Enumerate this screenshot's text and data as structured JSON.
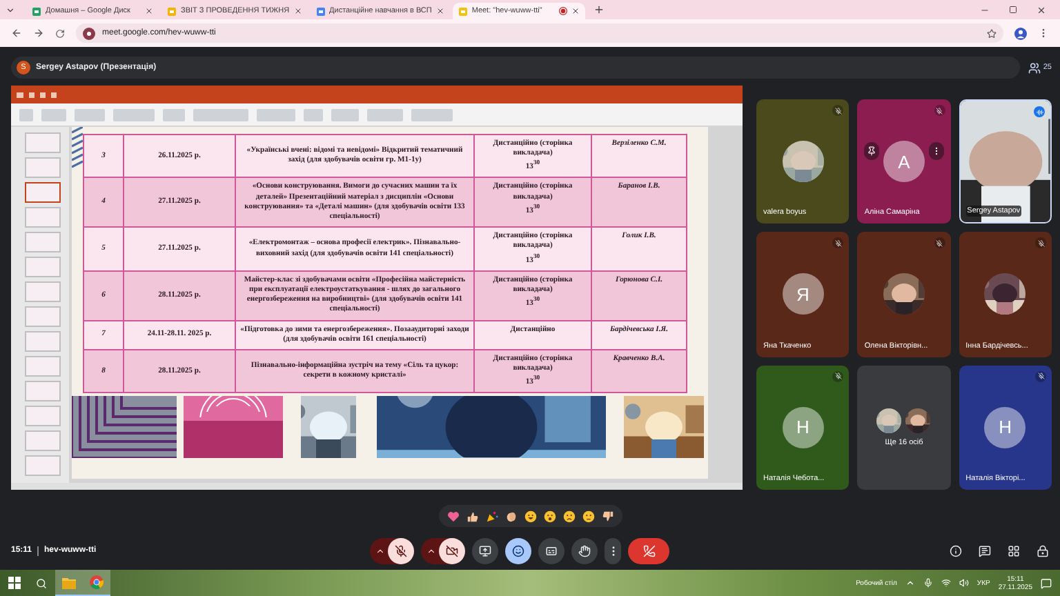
{
  "browser": {
    "tabs": [
      {
        "title": "Домашня – Google Диск",
        "kind": "drive",
        "selected": false
      },
      {
        "title": "ЗВІТ З ПРОВЕДЕННЯ ТИЖНЯ",
        "kind": "slides",
        "selected": false
      },
      {
        "title": "Дистанційне навчання в ВСП",
        "kind": "docs",
        "selected": false
      },
      {
        "title": "Meet: \"hev-wuww-tti\"",
        "kind": "meet",
        "selected": true,
        "recording": true
      }
    ],
    "url": "meet.google.com/hev-wuww-tti"
  },
  "presenter": {
    "initial": "S",
    "label": "Sergey Astapov (Презентація)",
    "people_count": "25"
  },
  "powerpoint": {
    "slides": [
      {
        "selected": false
      },
      {
        "selected": false
      },
      {
        "selected": true
      },
      {
        "selected": false
      },
      {
        "selected": false
      },
      {
        "selected": false
      },
      {
        "selected": false
      },
      {
        "selected": false
      },
      {
        "selected": false
      },
      {
        "selected": false
      },
      {
        "selected": false
      },
      {
        "selected": false
      },
      {
        "selected": false
      },
      {
        "selected": false
      }
    ],
    "table": {
      "rows": [
        {
          "number": "3",
          "date": "26.11.2025 р.",
          "event": "«Українські вчені: відомі та невідомі» Відкритий тематичний захід (для здобувачів освіти гр.   М1-1у)",
          "format": "Дистанційно (сторінка викладача)",
          "time": "13$^{30}$",
          "responsible": "Верзіленко С.М."
        },
        {
          "number": "4",
          "date": "27.11.2025 р.",
          "event": "«Основи конструювання. Вимоги до сучасних машин та їх деталей» Презентаційний матеріал з дисциплін «Основи конструювання» та «Деталі машин» (для здобувачів освіти 133 спеціальності)",
          "format": "Дистанційно (сторінка викладача)",
          "time": "13$^{30}$",
          "responsible": "Баранов І.В."
        },
        {
          "number": "5",
          "date": "27.11.2025 р.",
          "event": "«Електромонтаж – основа професії електрик». Пізнавально-виховний захід (для здобувачів освіти 141 спеціальності)",
          "format": "Дистанційно (сторінка викладача)",
          "time": "13$^{30}$",
          "responsible": "Голик І.В."
        },
        {
          "number": "6",
          "date": "28.11.2025 р.",
          "event": "Майстер-клас зі здобувачами освіти «Професійна майстерність при експлуатації електроустаткування - шлях до загального енергозбереження на виробництві» (для здобувачів освіти 141 спеціальності)",
          "format": "Дистанційно (сторінка викладача)",
          "time": "13$^{30}$",
          "responsible": "Горюнова С.І."
        },
        {
          "number": "7",
          "date": "24.11-28.11. 2025 р.",
          "event": "«Підготовка до зими та енергозбереження». Позааудиторні заходи (для здобувачів освіти 161 спеціальності)",
          "format": "Дистанційно",
          "responsible": "Бардічевська І.Я."
        },
        {
          "number": "8",
          "date": "28.11.2025 р.",
          "event": "Пізнавально-інформаційна зустріч на тему «Сіль та цукор: секрети в кожному кристалі»",
          "format": "Дистанційно (сторінка викладача)",
          "time": "13$^{30}$",
          "responsible": "Кравченко В.А."
        }
      ]
    }
  },
  "participants": [
    {
      "name": "valera boyus",
      "color": "#4a4a1c",
      "muted": true
    },
    {
      "name": "Аліна Самаріна",
      "kind": "letter",
      "letter": "A",
      "color": "#8c1d50",
      "muted": true,
      "hovered": true
    },
    {
      "name": "Sergey Astapov",
      "kind": "video",
      "muted": false
    },
    {
      "name": "Яна Ткаченко",
      "kind": "letter",
      "letter": "Я",
      "color": "#5a2818",
      "muted": true
    },
    {
      "name": "Олена Вікторівн...",
      "color": "#5a2818",
      "muted": true
    },
    {
      "name": "Інна Бардічевсь...",
      "color": "#5a2818",
      "muted": true
    },
    {
      "name": "Наталія Чебота...",
      "kind": "letter",
      "letter": "Н",
      "color": "#2f5a1c",
      "muted": true
    },
    {
      "name": "Ще 16 осіб",
      "kind": "more",
      "color": "#3a3b3e"
    },
    {
      "name": "Наталія Вікторі...",
      "kind": "letter",
      "letter": "Н",
      "color": "#27358a",
      "muted": true
    }
  ],
  "reactions": [
    {
      "kind": "heart"
    },
    {
      "kind": "thumbs_up"
    },
    {
      "kind": "party"
    },
    {
      "kind": "clap"
    },
    {
      "kind": "laugh"
    },
    {
      "kind": "surprised"
    },
    {
      "kind": "sad"
    },
    {
      "kind": "thinking"
    },
    {
      "kind": "thumbs_down"
    }
  ],
  "call": {
    "time": "15:11",
    "code": "hev-wuww-tti",
    "controls": [
      {
        "kind": "mic",
        "on": false
      },
      {
        "kind": "camera",
        "on": false
      },
      {
        "kind": "present"
      },
      {
        "kind": "reactions",
        "active": true
      },
      {
        "kind": "captions",
        "active": false
      },
      {
        "kind": "hand",
        "active": false
      },
      {
        "kind": "more"
      },
      {
        "kind": "end"
      }
    ],
    "side": [
      {
        "kind": "info"
      },
      {
        "kind": "chat"
      },
      {
        "kind": "activities"
      },
      {
        "kind": "host"
      }
    ]
  },
  "taskbar": {
    "apps": [
      {
        "kind": "explorer",
        "active": true
      },
      {
        "kind": "chrome",
        "active": true
      }
    ],
    "desktop_label": "Робочий стіл",
    "language": "УКР",
    "time": "15:11",
    "date": "27.11.2025"
  }
}
